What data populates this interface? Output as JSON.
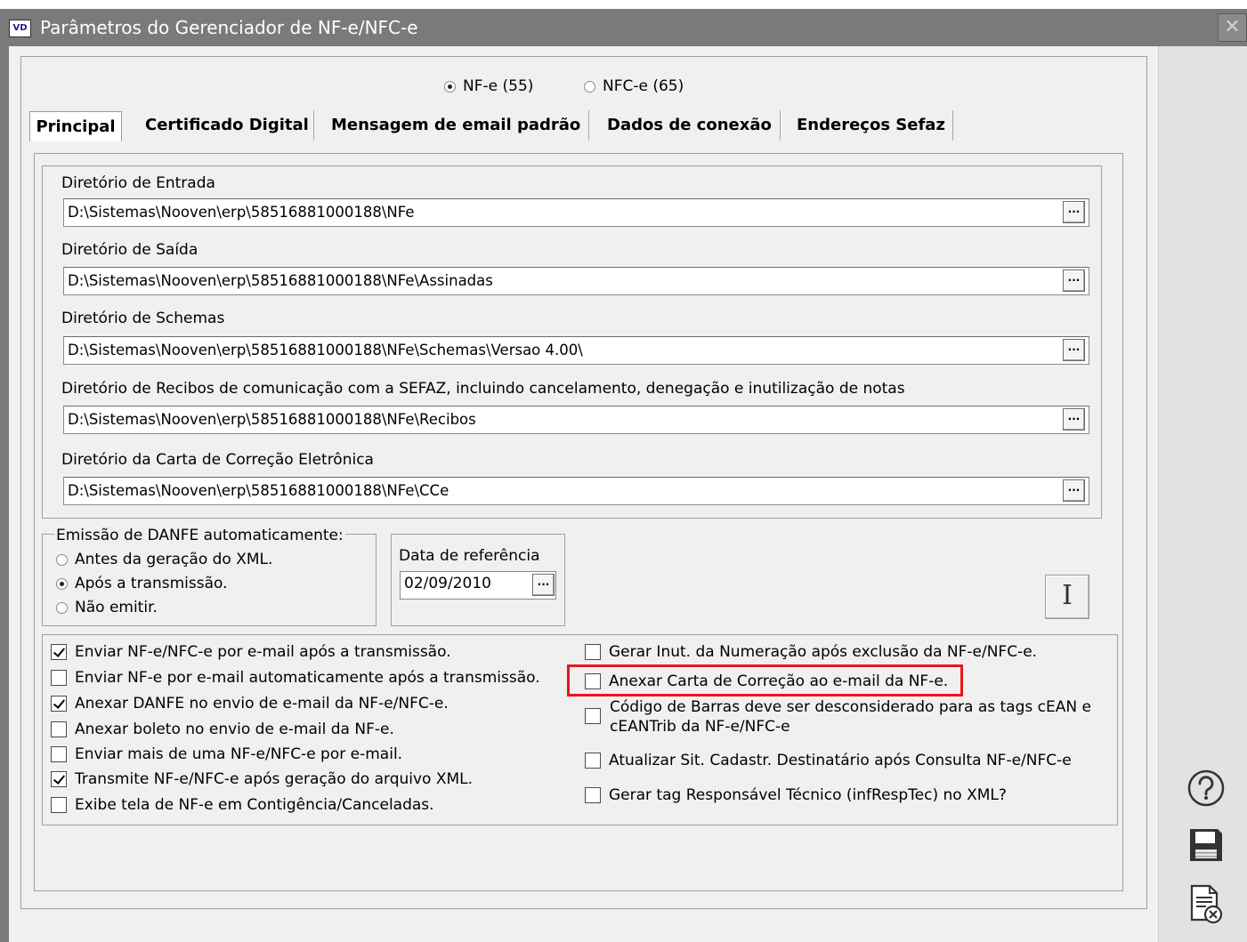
{
  "window": {
    "app_icon": "VD",
    "title": "Parâmetros do Gerenciador de NF-e/NFC-e",
    "close_glyph": "✕"
  },
  "model_selector": {
    "options": [
      {
        "label": "NF-e (55)",
        "checked": true
      },
      {
        "label": "NFC-e (65)",
        "checked": false
      }
    ]
  },
  "tabs": [
    {
      "label": "Principal",
      "active": true
    },
    {
      "label": "Certificado Digital",
      "active": false
    },
    {
      "label": "Mensagem de email padrão",
      "active": false
    },
    {
      "label": "Dados de conexão",
      "active": false
    },
    {
      "label": "Endereços Sefaz",
      "active": false
    }
  ],
  "directories": [
    {
      "label": "Diretório de Entrada",
      "value": "D:\\Sistemas\\Nooven\\erp\\58516881000188\\NFe",
      "button": "..."
    },
    {
      "label": "Diretório de Saída",
      "value": "D:\\Sistemas\\Nooven\\erp\\58516881000188\\NFe\\Assinadas",
      "button": "..."
    },
    {
      "label": "Diretório de Schemas",
      "value": "D:\\Sistemas\\Nooven\\erp\\58516881000188\\NFe\\Schemas\\Versao 4.00\\",
      "button": "..."
    },
    {
      "label": "Diretório de Recibos de comunicação com a SEFAZ, incluindo cancelamento, denegação e inutilização de notas",
      "value": "D:\\Sistemas\\Nooven\\erp\\58516881000188\\NFe\\Recibos",
      "button": "..."
    },
    {
      "label": "Diretório da Carta de Correção Eletrônica",
      "value": "D:\\Sistemas\\Nooven\\erp\\58516881000188\\NFe\\CCe",
      "button": "..."
    }
  ],
  "danfe": {
    "legend": "Emissão de DANFE automaticamente:",
    "options": [
      {
        "label": "Antes da geração do XML.",
        "checked": false
      },
      {
        "label": "Após a transmissão.",
        "checked": true
      },
      {
        "label": "Não emitir.",
        "checked": false
      }
    ]
  },
  "data_referencia": {
    "label": "Data de referência",
    "value": "02/09/2010",
    "button": "..."
  },
  "i_button": "I",
  "options_left": [
    {
      "label": "Enviar NF-e/NFC-e por e-mail após a transmissão.",
      "checked": true
    },
    {
      "label": "Enviar NF-e por e-mail automaticamente após a transmissão.",
      "checked": false
    },
    {
      "label": "Anexar DANFE no envio de e-mail da NF-e/NFC-e.",
      "checked": true
    },
    {
      "label": "Anexar boleto no envio de e-mail da NF-e.",
      "checked": false
    },
    {
      "label": "Enviar mais de uma NF-e/NFC-e por e-mail.",
      "checked": false
    },
    {
      "label": "Transmite NF-e/NFC-e após geração do arquivo XML.",
      "checked": true
    },
    {
      "label": "Exibe tela de NF-e em Contigência/Canceladas.",
      "checked": false
    }
  ],
  "options_right": [
    {
      "label": "Gerar Inut. da Numeração após exclusão da NF-e/NFC-e.",
      "checked": false
    },
    {
      "label": "Anexar Carta de Correção ao e-mail da NF-e.",
      "checked": false,
      "highlighted": true
    },
    {
      "label": "Código de Barras deve ser desconsiderado para as tags cEAN e",
      "label_line2": "cEANTrib da NF-e/NFC-e",
      "checked": false
    },
    {
      "label": "Atualizar Sit. Cadastr. Destinatário após Consulta NF-e/NFC-e",
      "checked": false
    },
    {
      "label": "Gerar tag Responsável Técnico (infRespTec) no XML?",
      "checked": false
    }
  ],
  "side_icons": [
    "help-icon",
    "save-icon",
    "cancel-document-icon"
  ],
  "colors": {
    "titlebar": "#7a7a7a",
    "highlight": "#e8161b",
    "background": "#f0f0f0"
  }
}
